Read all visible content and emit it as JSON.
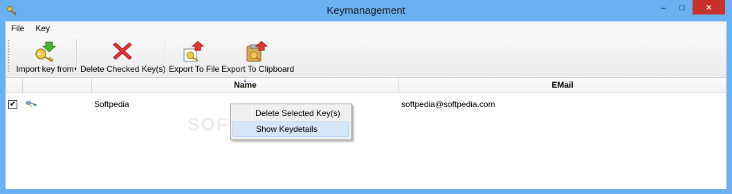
{
  "window": {
    "title": "Keymanagement",
    "min_glyph": "–",
    "max_glyph": "□",
    "close_glyph": "✕"
  },
  "menu": [
    "File",
    "Key"
  ],
  "toolbar": {
    "import_label": "Import key from",
    "delete_label": "Delete Checked Key(s)",
    "export_file_label": "Export To File",
    "export_clipboard_label": "Export To Clipboard"
  },
  "grid": {
    "columns": [
      "",
      "",
      "Name",
      "EMail"
    ],
    "rows": [
      {
        "checked": true,
        "check_glyph": "✔",
        "icon": "key-icon",
        "name": "Softpedia",
        "email": "softpedia@softpedia.com"
      }
    ]
  },
  "watermark": "SOFTPEDIA",
  "context_menu": {
    "items": [
      "Delete Selected Key(s)",
      "Show Keydetails"
    ],
    "selected_index": 1
  },
  "colors": {
    "frame": "#6ab1f2",
    "close_button": "#c7302b",
    "selection": "#d5e6f8"
  }
}
